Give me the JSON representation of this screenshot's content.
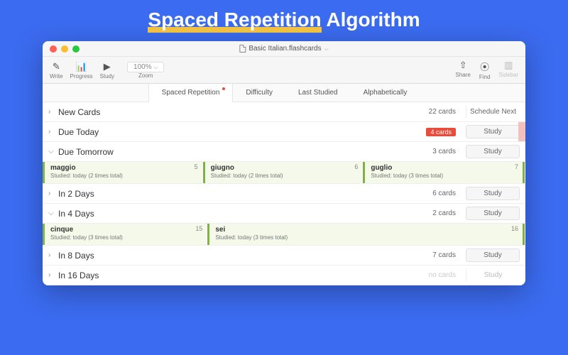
{
  "hero": {
    "highlighted": "Spaced Repetition",
    "rest": " Algorithm"
  },
  "window": {
    "title": "Basic Italian.flashcards"
  },
  "toolbar": {
    "write": "Write",
    "progress": "Progress",
    "study": "Study",
    "zoom_value": "100%",
    "zoom_label": "Zoom",
    "share": "Share",
    "find": "Find",
    "sidebar": "Sidebar"
  },
  "tabs": {
    "spaced": "Spaced Repetition",
    "difficulty": "Difficulty",
    "last_studied": "Last Studied",
    "alpha": "Alphabetically"
  },
  "sections": {
    "new_cards": {
      "title": "New Cards",
      "count": "22 cards",
      "action": "Schedule Next"
    },
    "due_today": {
      "title": "Due Today",
      "badge": "4 cards",
      "action": "Study"
    },
    "due_tomorrow": {
      "title": "Due Tomorrow",
      "count": "3 cards",
      "action": "Study"
    },
    "in_2_days": {
      "title": "In 2 Days",
      "count": "6 cards",
      "action": "Study"
    },
    "in_4_days": {
      "title": "In 4 Days",
      "count": "2 cards",
      "action": "Study"
    },
    "in_8_days": {
      "title": "In 8 Days",
      "count": "7 cards",
      "action": "Study"
    },
    "in_16_days": {
      "title": "In 16 Days",
      "count": "no cards",
      "action": "Study"
    }
  },
  "cards_tomorrow": [
    {
      "num": "5",
      "title": "maggio",
      "sub": "Studied: today (2 times total)"
    },
    {
      "num": "6",
      "title": "giugno",
      "sub": "Studied: today (2 times total)"
    },
    {
      "num": "7",
      "title": "guglio",
      "sub": "Studied: today (3 times total)"
    }
  ],
  "cards_4days": [
    {
      "num": "15",
      "title": "cinque",
      "sub": "Studied: today (3 times total)"
    },
    {
      "num": "16",
      "title": "sei",
      "sub": "Studied: today (3 times total)"
    }
  ]
}
